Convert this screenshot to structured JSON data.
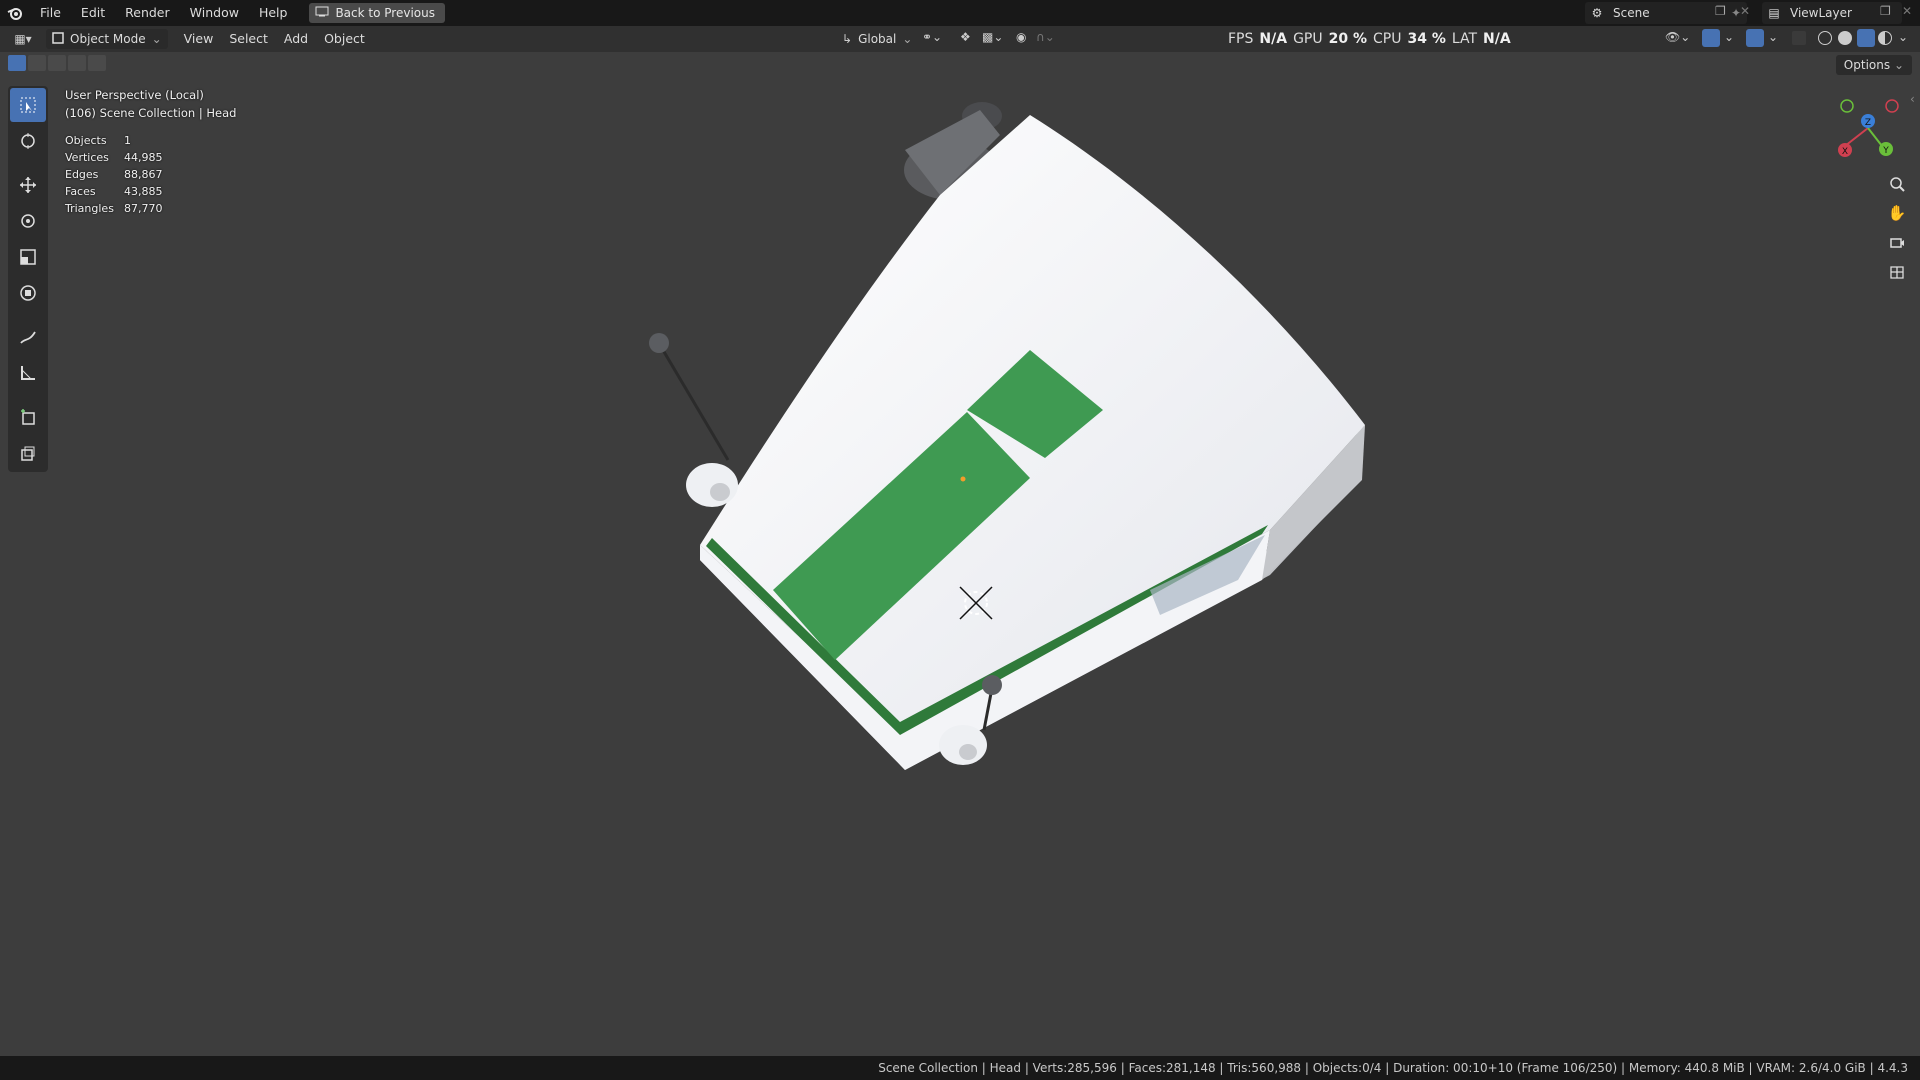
{
  "menu": {
    "items": [
      "File",
      "Edit",
      "Render",
      "Window",
      "Help"
    ],
    "back_button": "Back to Previous"
  },
  "top_right": {
    "scene_name": "Scene",
    "view_layer": "ViewLayer"
  },
  "header": {
    "mode": "Object Mode",
    "menus": [
      "View",
      "Select",
      "Add",
      "Object"
    ],
    "orientation": "Global",
    "options_label": "Options"
  },
  "performance": {
    "fps_label": "FPS",
    "fps_value": "N/A",
    "gpu_label": "GPU",
    "gpu_value": "20 %",
    "cpu_label": "CPU",
    "cpu_value": "34 %",
    "lat_label": "LAT",
    "lat_value": "N/A"
  },
  "overlay": {
    "view_name": "User Perspective (Local)",
    "collection": "(106) Scene Collection | Head",
    "stats": [
      {
        "key": "Objects",
        "value": "1"
      },
      {
        "key": "Vertices",
        "value": "44,985"
      },
      {
        "key": "Edges",
        "value": "88,867"
      },
      {
        "key": "Faces",
        "value": "43,885"
      },
      {
        "key": "Triangles",
        "value": "87,770"
      }
    ]
  },
  "gizmo": {
    "x": "X",
    "y": "Y",
    "z": "Z"
  },
  "status": {
    "text": "Scene Collection | Head | Verts:285,596 | Faces:281,148 | Tris:560,988 | Objects:0/4 | Duration: 00:10+10 (Frame 106/250) | Memory: 440.8 MiB | VRAM: 2.6/4.0 GiB | 4.4.3"
  },
  "colors": {
    "accent": "#4772b3",
    "viewport_bg": "#3d3d3d",
    "model_white": "#f0f1f4",
    "model_green": "#3f9a52"
  },
  "icons": [
    "blender-logo-icon",
    "select-box-icon",
    "cursor-icon",
    "move-icon",
    "rotate-icon",
    "scale-icon",
    "transform-icon",
    "annotate-icon",
    "measure-icon",
    "add-cube-icon",
    "extrude-icon",
    "zoom-icon",
    "pan-hand-icon",
    "camera-icon",
    "grid-icon"
  ]
}
